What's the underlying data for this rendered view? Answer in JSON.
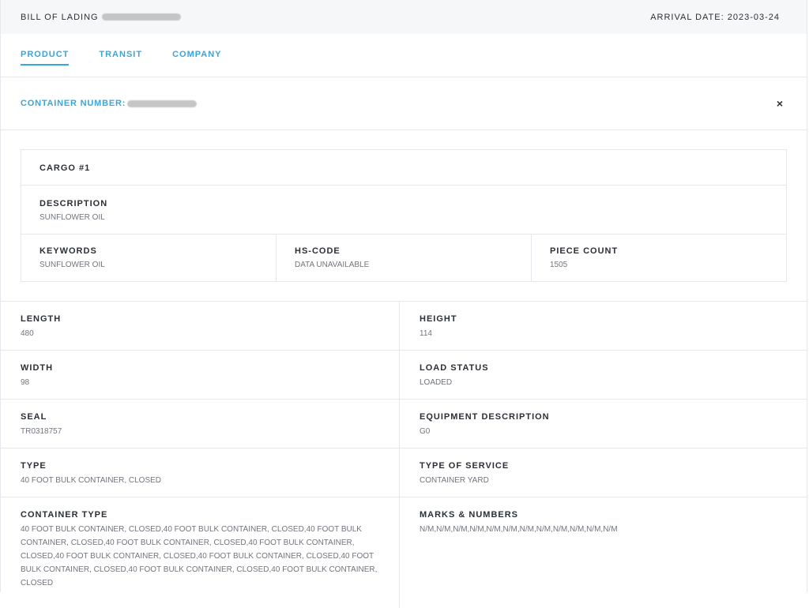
{
  "header": {
    "bill_of_lading_label": "BILL OF LADING",
    "arrival_date": "ARRIVAL DATE: 2023-03-24"
  },
  "tabs": [
    {
      "label": "PRODUCT",
      "active": true
    },
    {
      "label": "TRANSIT",
      "active": false
    },
    {
      "label": "COMPANY",
      "active": false
    }
  ],
  "container": {
    "label": "CONTAINER NUMBER:",
    "close_label": "×"
  },
  "cargo": {
    "title": "CARGO #1",
    "description_label": "DESCRIPTION",
    "description_value": "SUNFLOWER OIL",
    "keywords_label": "KEYWORDS",
    "keywords_value": "SUNFLOWER OIL",
    "hscode_label": "HS-CODE",
    "hscode_value": "DATA UNAVAILABLE",
    "piece_count_label": "PIECE COUNT",
    "piece_count_value": "1505"
  },
  "details": {
    "length_label": "LENGTH",
    "length_value": "480",
    "height_label": "HEIGHT",
    "height_value": "114",
    "width_label": "WIDTH",
    "width_value": "98",
    "load_status_label": "LOAD STATUS",
    "load_status_value": "LOADED",
    "seal_label": "SEAL",
    "seal_value": "TR0318757",
    "equipment_label": "EQUIPMENT DESCRIPTION",
    "equipment_value": "G0",
    "type_label": "TYPE",
    "type_value": "40 FOOT BULK CONTAINER, CLOSED",
    "service_label": "TYPE OF SERVICE",
    "service_value": "CONTAINER YARD",
    "container_type_label": "CONTAINER TYPE",
    "container_type_value": "40 FOOT BULK CONTAINER, CLOSED,40 FOOT BULK CONTAINER, CLOSED,40 FOOT BULK CONTAINER, CLOSED,40 FOOT BULK CONTAINER, CLOSED,40 FOOT BULK CONTAINER, CLOSED,40 FOOT BULK CONTAINER, CLOSED,40 FOOT BULK CONTAINER, CLOSED,40 FOOT BULK CONTAINER, CLOSED,40 FOOT BULK CONTAINER, CLOSED,40 FOOT BULK CONTAINER, CLOSED",
    "marks_label": "MARKS & NUMBERS",
    "marks_value": "N/M,N/M,N/M,N/M,N/M,N/M,N/M,N/M,N/M,N/M,N/M,N/M"
  },
  "colors": {
    "accent": "#3aa6d8",
    "header_bg": "#f5f7f9",
    "border": "#e4e7eb"
  }
}
